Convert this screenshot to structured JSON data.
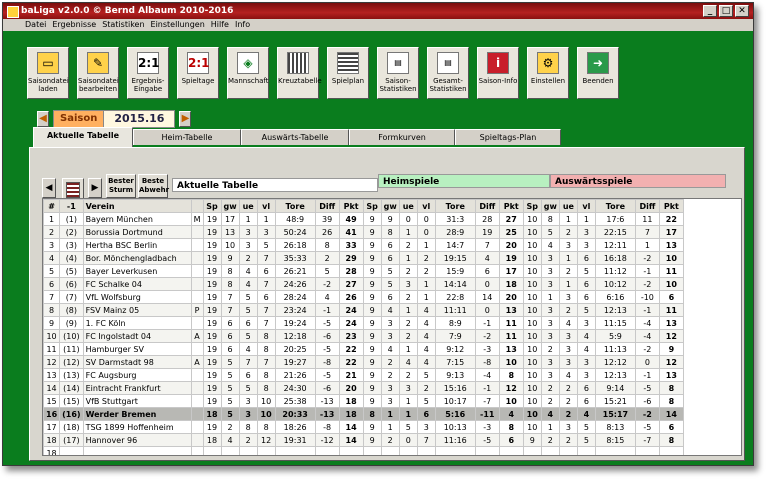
{
  "window": {
    "title": "baLiga v2.0.0 © Bernd Albaum 2010-2016"
  },
  "menu": [
    "Datei",
    "Ergebnisse",
    "Statistiken",
    "Einstellungen",
    "Hilfe",
    "Info"
  ],
  "toolbar": [
    {
      "label": "Saisondatei laden",
      "icon": "folder-open-icon"
    },
    {
      "label": "Saisondatei bearbeiten",
      "icon": "folder-edit-icon"
    },
    {
      "label": "Ergebnis-Eingabe",
      "icon": "score-entry-icon"
    },
    {
      "label": "Spieltage",
      "icon": "matchday-icon"
    },
    {
      "label": "Mannschaft",
      "icon": "team-icon"
    },
    {
      "label": "Kreuztabelle",
      "icon": "cross-table-icon"
    },
    {
      "label": "Spielplan",
      "icon": "schedule-icon"
    },
    {
      "label": "Saison-Statistiken",
      "icon": "season-stats-icon"
    },
    {
      "label": "Gesamt-Statistiken",
      "icon": "total-stats-icon"
    },
    {
      "label": "Saison-Info",
      "icon": "season-info-icon"
    },
    {
      "label": "Einstellen",
      "icon": "settings-icon"
    },
    {
      "label": "Beenden",
      "icon": "exit-icon"
    }
  ],
  "season": {
    "label": "Saison",
    "value": "2015.16"
  },
  "tabs": [
    "Aktuelle Tabelle",
    "Heim-Tabelle",
    "Auswärts-Tabelle",
    "Formkurven",
    "Spieltags-Plan"
  ],
  "filters": {
    "best_attack": "Bester Sturm",
    "best_defense": "Beste Abwehr"
  },
  "sections": {
    "current": "Aktuelle Tabelle",
    "home": "Heimspiele",
    "away": "Auswärtsspiele"
  },
  "columns": {
    "main": [
      "#",
      "-1",
      "Verein",
      "",
      "Sp",
      "gw",
      "ue",
      "vl",
      "Tore",
      "Diff",
      "Pkt"
    ],
    "home": [
      "Sp",
      "gw",
      "ue",
      "vl",
      "Tore",
      "Diff",
      "Pkt"
    ],
    "away": [
      "Sp",
      "gw",
      "ue",
      "vl",
      "Tore",
      "Diff",
      "Pkt"
    ]
  },
  "rows": [
    {
      "pos": "1",
      "prev": "(1)",
      "team": "Bayern München",
      "mark": "M",
      "sp": "19",
      "gw": "17",
      "ue": "1",
      "vl": "1",
      "tore": "48:9",
      "diff": "39",
      "pkt": "49",
      "h": [
        "9",
        "9",
        "0",
        "0",
        "31:3",
        "28",
        "27"
      ],
      "a": [
        "10",
        "8",
        "1",
        "1",
        "17:6",
        "11",
        "22"
      ]
    },
    {
      "pos": "2",
      "prev": "(2)",
      "team": "Borussia Dortmund",
      "mark": "",
      "sp": "19",
      "gw": "13",
      "ue": "3",
      "vl": "3",
      "tore": "50:24",
      "diff": "26",
      "pkt": "41",
      "h": [
        "9",
        "8",
        "1",
        "0",
        "28:9",
        "19",
        "25"
      ],
      "a": [
        "10",
        "5",
        "2",
        "3",
        "22:15",
        "7",
        "17"
      ]
    },
    {
      "pos": "3",
      "prev": "(3)",
      "team": "Hertha BSC Berlin",
      "mark": "",
      "sp": "19",
      "gw": "10",
      "ue": "3",
      "vl": "5",
      "tore": "26:18",
      "diff": "8",
      "pkt": "33",
      "h": [
        "9",
        "6",
        "2",
        "1",
        "14:7",
        "7",
        "20"
      ],
      "a": [
        "10",
        "4",
        "3",
        "3",
        "12:11",
        "1",
        "13"
      ]
    },
    {
      "pos": "4",
      "prev": "(4)",
      "team": "Bor. Mönchengladbach",
      "mark": "",
      "sp": "19",
      "gw": "9",
      "ue": "2",
      "vl": "7",
      "tore": "35:33",
      "diff": "2",
      "pkt": "29",
      "h": [
        "9",
        "6",
        "1",
        "2",
        "19:15",
        "4",
        "19"
      ],
      "a": [
        "10",
        "3",
        "1",
        "6",
        "16:18",
        "-2",
        "10"
      ]
    },
    {
      "pos": "5",
      "prev": "(5)",
      "team": "Bayer Leverkusen",
      "mark": "",
      "sp": "19",
      "gw": "8",
      "ue": "4",
      "vl": "6",
      "tore": "26:21",
      "diff": "5",
      "pkt": "28",
      "h": [
        "9",
        "5",
        "2",
        "2",
        "15:9",
        "6",
        "17"
      ],
      "a": [
        "10",
        "3",
        "2",
        "5",
        "11:12",
        "-1",
        "11"
      ]
    },
    {
      "pos": "6",
      "prev": "(6)",
      "team": "FC Schalke 04",
      "mark": "",
      "sp": "19",
      "gw": "8",
      "ue": "4",
      "vl": "7",
      "tore": "24:26",
      "diff": "-2",
      "pkt": "27",
      "h": [
        "9",
        "5",
        "3",
        "1",
        "14:14",
        "0",
        "18"
      ],
      "a": [
        "10",
        "3",
        "1",
        "6",
        "10:12",
        "-2",
        "10"
      ]
    },
    {
      "pos": "7",
      "prev": "(7)",
      "team": "VfL Wolfsburg",
      "mark": "",
      "sp": "19",
      "gw": "7",
      "ue": "5",
      "vl": "6",
      "tore": "28:24",
      "diff": "4",
      "pkt": "26",
      "h": [
        "9",
        "6",
        "2",
        "1",
        "22:8",
        "14",
        "20"
      ],
      "a": [
        "10",
        "1",
        "3",
        "6",
        "6:16",
        "-10",
        "6"
      ]
    },
    {
      "pos": "8",
      "prev": "(8)",
      "team": "FSV Mainz 05",
      "mark": "P",
      "sp": "19",
      "gw": "7",
      "ue": "5",
      "vl": "7",
      "tore": "23:24",
      "diff": "-1",
      "pkt": "24",
      "h": [
        "9",
        "4",
        "1",
        "4",
        "11:11",
        "0",
        "13"
      ],
      "a": [
        "10",
        "3",
        "2",
        "5",
        "12:13",
        "-1",
        "11"
      ]
    },
    {
      "pos": "9",
      "prev": "(9)",
      "team": "1. FC Köln",
      "mark": "",
      "sp": "19",
      "gw": "6",
      "ue": "6",
      "vl": "7",
      "tore": "19:24",
      "diff": "-5",
      "pkt": "24",
      "h": [
        "9",
        "3",
        "2",
        "4",
        "8:9",
        "-1",
        "11"
      ],
      "a": [
        "10",
        "3",
        "4",
        "3",
        "11:15",
        "-4",
        "13"
      ]
    },
    {
      "pos": "10",
      "prev": "(10)",
      "team": "FC Ingolstadt 04",
      "mark": "A",
      "sp": "19",
      "gw": "6",
      "ue": "5",
      "vl": "8",
      "tore": "12:18",
      "diff": "-6",
      "pkt": "23",
      "h": [
        "9",
        "3",
        "2",
        "4",
        "7:9",
        "-2",
        "11"
      ],
      "a": [
        "10",
        "3",
        "3",
        "4",
        "5:9",
        "-4",
        "12"
      ]
    },
    {
      "pos": "11",
      "prev": "(11)",
      "team": "Hamburger SV",
      "mark": "",
      "sp": "19",
      "gw": "6",
      "ue": "4",
      "vl": "8",
      "tore": "20:25",
      "diff": "-5",
      "pkt": "22",
      "h": [
        "9",
        "4",
        "1",
        "4",
        "9:12",
        "-3",
        "13"
      ],
      "a": [
        "10",
        "2",
        "3",
        "4",
        "11:13",
        "-2",
        "9"
      ]
    },
    {
      "pos": "12",
      "prev": "(12)",
      "team": "SV Darmstadt 98",
      "mark": "A",
      "sp": "19",
      "gw": "5",
      "ue": "7",
      "vl": "7",
      "tore": "19:27",
      "diff": "-8",
      "pkt": "22",
      "h": [
        "9",
        "2",
        "4",
        "4",
        "7:15",
        "-8",
        "10"
      ],
      "a": [
        "10",
        "3",
        "3",
        "3",
        "12:12",
        "0",
        "12"
      ]
    },
    {
      "pos": "13",
      "prev": "(13)",
      "team": "FC Augsburg",
      "mark": "",
      "sp": "19",
      "gw": "5",
      "ue": "6",
      "vl": "8",
      "tore": "21:26",
      "diff": "-5",
      "pkt": "21",
      "h": [
        "9",
        "2",
        "2",
        "5",
        "9:13",
        "-4",
        "8"
      ],
      "a": [
        "10",
        "3",
        "4",
        "3",
        "12:13",
        "-1",
        "13"
      ]
    },
    {
      "pos": "14",
      "prev": "(14)",
      "team": "Eintracht Frankfurt",
      "mark": "",
      "sp": "19",
      "gw": "5",
      "ue": "5",
      "vl": "8",
      "tore": "24:30",
      "diff": "-6",
      "pkt": "20",
      "h": [
        "9",
        "3",
        "3",
        "2",
        "15:16",
        "-1",
        "12"
      ],
      "a": [
        "10",
        "2",
        "2",
        "6",
        "9:14",
        "-5",
        "8"
      ]
    },
    {
      "pos": "15",
      "prev": "(15)",
      "team": "VfB Stuttgart",
      "mark": "",
      "sp": "19",
      "gw": "5",
      "ue": "3",
      "vl": "10",
      "tore": "25:38",
      "diff": "-13",
      "pkt": "18",
      "h": [
        "9",
        "3",
        "1",
        "5",
        "10:17",
        "-7",
        "10"
      ],
      "a": [
        "10",
        "2",
        "2",
        "6",
        "15:21",
        "-6",
        "8"
      ]
    },
    {
      "pos": "16",
      "prev": "(16)",
      "team": "Werder Bremen",
      "mark": "",
      "sp": "18",
      "gw": "5",
      "ue": "3",
      "vl": "10",
      "tore": "20:33",
      "diff": "-13",
      "pkt": "18",
      "h": [
        "8",
        "1",
        "1",
        "6",
        "5:16",
        "-11",
        "4"
      ],
      "a": [
        "10",
        "4",
        "2",
        "4",
        "15:17",
        "-2",
        "14"
      ]
    },
    {
      "pos": "17",
      "prev": "(18)",
      "team": "TSG 1899 Hoffenheim",
      "mark": "",
      "sp": "19",
      "gw": "2",
      "ue": "8",
      "vl": "8",
      "tore": "18:26",
      "diff": "-8",
      "pkt": "14",
      "h": [
        "9",
        "1",
        "5",
        "3",
        "10:13",
        "-3",
        "8"
      ],
      "a": [
        "10",
        "1",
        "3",
        "5",
        "8:13",
        "-5",
        "6"
      ]
    },
    {
      "pos": "18",
      "prev": "(17)",
      "team": "Hannover 96",
      "mark": "",
      "sp": "18",
      "gw": "4",
      "ue": "2",
      "vl": "12",
      "tore": "19:31",
      "diff": "-12",
      "pkt": "14",
      "h": [
        "9",
        "2",
        "0",
        "7",
        "11:16",
        "-5",
        "6"
      ],
      "a": [
        "9",
        "2",
        "2",
        "5",
        "8:15",
        "-7",
        "8"
      ]
    }
  ],
  "extra_row": {
    "pos": "18"
  },
  "colors": {
    "frame": "#0a7d1e",
    "title": "#9a1515",
    "home_header": "#b8f0c0",
    "away_header": "#f2b0b0",
    "season_label": "#ffb060"
  }
}
